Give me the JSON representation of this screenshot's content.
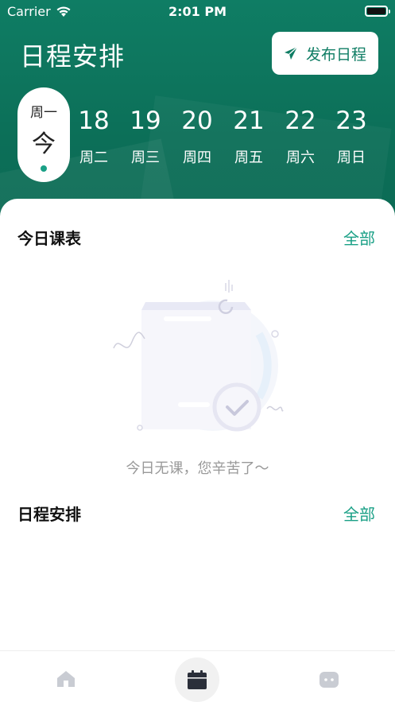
{
  "status_bar": {
    "carrier": "Carrier",
    "time": "2:01 PM"
  },
  "header": {
    "title": "日程安排",
    "publish_button": "发布日程"
  },
  "week": {
    "today": {
      "weekday": "周一",
      "label": "今"
    },
    "days": [
      {
        "date": "18",
        "weekday": "周二"
      },
      {
        "date": "19",
        "weekday": "周三"
      },
      {
        "date": "20",
        "weekday": "周四"
      },
      {
        "date": "21",
        "weekday": "周五"
      },
      {
        "date": "22",
        "weekday": "周六"
      },
      {
        "date": "23",
        "weekday": "周日"
      }
    ]
  },
  "today_classes": {
    "title": "今日课表",
    "link": "全部",
    "empty_text": "今日无课，您辛苦了～"
  },
  "schedule": {
    "title": "日程安排",
    "link": "全部"
  },
  "tabbar": {
    "items": [
      {
        "icon": "home-icon",
        "active": false
      },
      {
        "icon": "calendar-icon",
        "active": true
      },
      {
        "icon": "message-icon",
        "active": false
      }
    ]
  },
  "colors": {
    "brand": "#0f7d64",
    "accent": "#1aa086",
    "muted": "#999999"
  }
}
